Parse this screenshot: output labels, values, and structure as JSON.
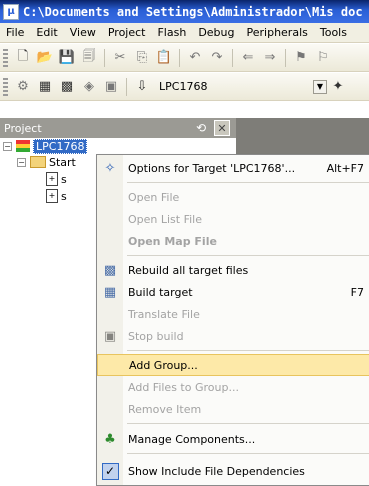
{
  "window": {
    "title": "C:\\Documents and Settings\\Administrador\\Mis doc"
  },
  "menubar": {
    "items": [
      "File",
      "Edit",
      "View",
      "Project",
      "Flash",
      "Debug",
      "Peripherals",
      "Tools"
    ]
  },
  "toolbar2": {
    "target_name": "LPC1768"
  },
  "project_panel": {
    "title": "Project",
    "tree": {
      "root_label": "LPC1768",
      "group_label": "Start",
      "file1_label": "s",
      "file2_label": "s"
    }
  },
  "context_menu": {
    "items": [
      {
        "label": "Options for Target 'LPC1768'...",
        "shortcut": "Alt+F7",
        "icon": "magic-wand-icon",
        "enabled": true
      },
      {
        "label": "Open File",
        "enabled": false
      },
      {
        "label": "Open List File",
        "enabled": false
      },
      {
        "label": "Open Map File",
        "enabled": false
      },
      {
        "label": "Rebuild all target files",
        "icon": "rebuild-icon",
        "enabled": true
      },
      {
        "label": "Build target",
        "shortcut": "F7",
        "icon": "build-icon",
        "enabled": true
      },
      {
        "label": "Translate File",
        "enabled": false
      },
      {
        "label": "Stop build",
        "icon": "stop-build-icon",
        "enabled": false
      },
      {
        "label": "Add Group...",
        "enabled": true,
        "highlighted": true
      },
      {
        "label": "Add Files to Group...",
        "enabled": false
      },
      {
        "label": "Remove Item",
        "enabled": false
      },
      {
        "label": "Manage Components...",
        "icon": "components-icon",
        "enabled": true
      },
      {
        "label": "Show Include File Dependencies",
        "icon": "check-icon",
        "enabled": true,
        "checked": true
      }
    ]
  },
  "colors": {
    "title_bar": "#2a5fd6",
    "menu_highlight": "#fde9a8",
    "selection": "#316ac5"
  }
}
